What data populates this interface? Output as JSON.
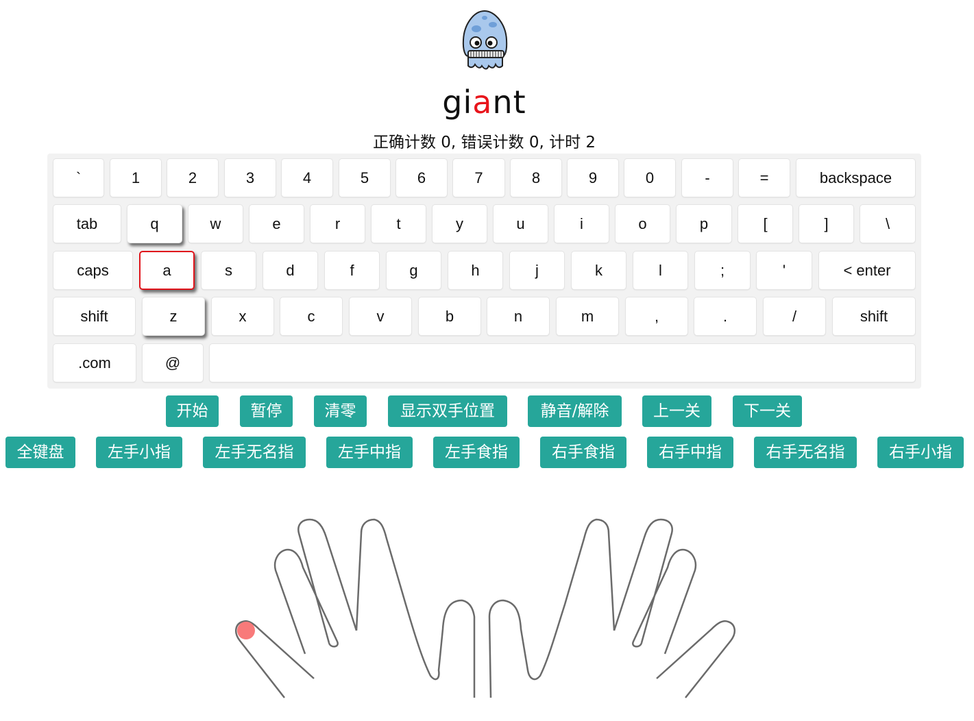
{
  "word": {
    "before": "gi",
    "current": "a",
    "after": "nt"
  },
  "stats": "正确计数 0, 错误计数 0, 计时 2",
  "keyboard": {
    "row1": [
      "`",
      "1",
      "2",
      "3",
      "4",
      "5",
      "6",
      "7",
      "8",
      "9",
      "0",
      "-",
      "=",
      "backspace"
    ],
    "row2": [
      "tab",
      "q",
      "w",
      "e",
      "r",
      "t",
      "y",
      "u",
      "i",
      "o",
      "p",
      "[",
      "]",
      "\\"
    ],
    "row3": [
      "caps",
      "a",
      "s",
      "d",
      "f",
      "g",
      "h",
      "j",
      "k",
      "l",
      ";",
      "'",
      "< enter"
    ],
    "row4": [
      "shift",
      "z",
      "x",
      "c",
      "v",
      "b",
      "n",
      "m",
      ",",
      ".",
      "/",
      "shift"
    ],
    "row5": [
      ".com",
      "@",
      ""
    ],
    "target_key": "a",
    "lifted_keys": [
      "q",
      "z"
    ]
  },
  "controls": [
    "开始",
    "暂停",
    "清零",
    "显示双手位置",
    "静音/解除",
    "上一关",
    "下一关"
  ],
  "fingers": [
    "全键盘",
    "左手小指",
    "左手无名指",
    "左手中指",
    "左手食指",
    "右手食指",
    "右手中指",
    "右手无名指",
    "右手小指"
  ],
  "colors": {
    "accent": "#26a69a",
    "target": "#e0141b",
    "fingertip": "#f87a7a"
  },
  "icons": {
    "mascot": "squid-mascot-icon"
  }
}
